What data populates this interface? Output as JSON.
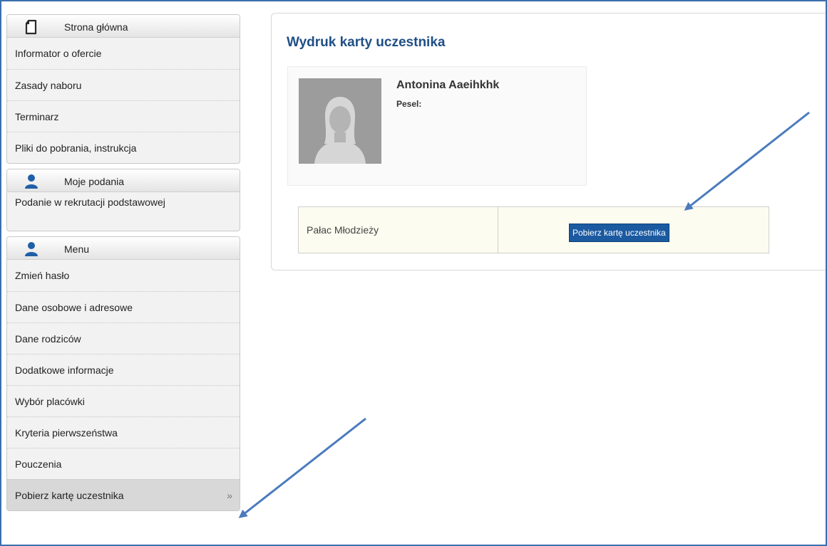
{
  "sidebar": {
    "sections": [
      {
        "icon": "document-icon",
        "title": "Strona główna",
        "items": [
          {
            "label": "Informator o ofercie"
          },
          {
            "label": "Zasady naboru"
          },
          {
            "label": "Terminarz"
          },
          {
            "label": "Pliki do pobrania, instrukcja"
          }
        ]
      },
      {
        "icon": "user-icon",
        "title": "Moje podania",
        "items": [
          {
            "label": "Podanie w rekrutacji podstawowej"
          }
        ]
      },
      {
        "icon": "user-icon",
        "title": "Menu",
        "items": [
          {
            "label": "Zmień hasło"
          },
          {
            "label": "Dane osobowe i adresowe"
          },
          {
            "label": "Dane rodziców"
          },
          {
            "label": "Dodatkowe informacje"
          },
          {
            "label": "Wybór placówki"
          },
          {
            "label": "Kryteria pierwszeństwa"
          },
          {
            "label": "Pouczenia"
          },
          {
            "label": "Pobierz kartę uczestnika",
            "active": true,
            "chevron": "»"
          }
        ]
      }
    ]
  },
  "main": {
    "title": "Wydruk karty uczestnika",
    "profile": {
      "name": "Antonina Aaeihkhk",
      "pesel_label": "Pesel:",
      "pesel_value": ""
    },
    "table": {
      "institution": "Pałac Młodzieży",
      "action_label": "Pobierz kartę uczestnika"
    }
  },
  "colors": {
    "accent": "#1f4f86",
    "button": "#1b5aa1",
    "arrow": "#4a7bbd",
    "frame": "#3b6fae"
  }
}
